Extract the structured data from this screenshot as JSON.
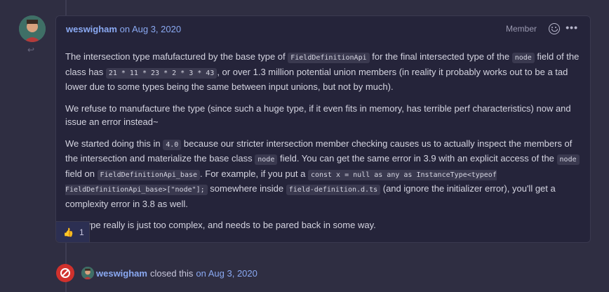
{
  "comment": {
    "author": "weswigham",
    "date": "on Aug 3, 2020",
    "badge": "Member",
    "more": "•••",
    "reply_icon": "↩",
    "p1": [
      "The intersection type mafufactured by the base type of ",
      "FieldDefinitionApi",
      " for the final intersected type of the ",
      "node",
      " field of the class has ",
      "21 * 11 * 23 * 2 * 3 * 43",
      ", or over 1.3 million potential union members (in reality it probably works out to be a tad lower due to some types being the same between input unions, but not by much)."
    ],
    "p2": "We refuse to manufacture the type (since such a huge type, if it even fits in memory, has terrible perf characteristics) now and issue an error instead~",
    "p3": [
      "We started doing this in ",
      "4.0",
      " because our stricter intersection member checking causes us to actually inspect the members of the intersection and materialize the base class ",
      "node",
      " field. You can get the same error in 3.9 with an explicit access of the ",
      "node",
      " field on ",
      "FieldDefinitionApi_base",
      ". For example, if you put a ",
      "const x = null as any as InstanceType<typeof FieldDefinitionApi_base>[\"node\"];",
      " somewhere inside ",
      "field-definition.d.ts",
      " (and ignore the initializer error), you'll get a complexity error in 3.8 as well."
    ],
    "p4": "The type really is just too complex, and needs to be pared back in some way.",
    "reaction": {
      "emoji": "👍",
      "count": "1"
    }
  },
  "event": {
    "author": "weswigham",
    "text": "closed this",
    "date": "on Aug 3, 2020"
  },
  "colors": {
    "background": "#2f2e42",
    "card": "#25243a",
    "link": "#8aa9f2",
    "closed": "#d0312d"
  }
}
